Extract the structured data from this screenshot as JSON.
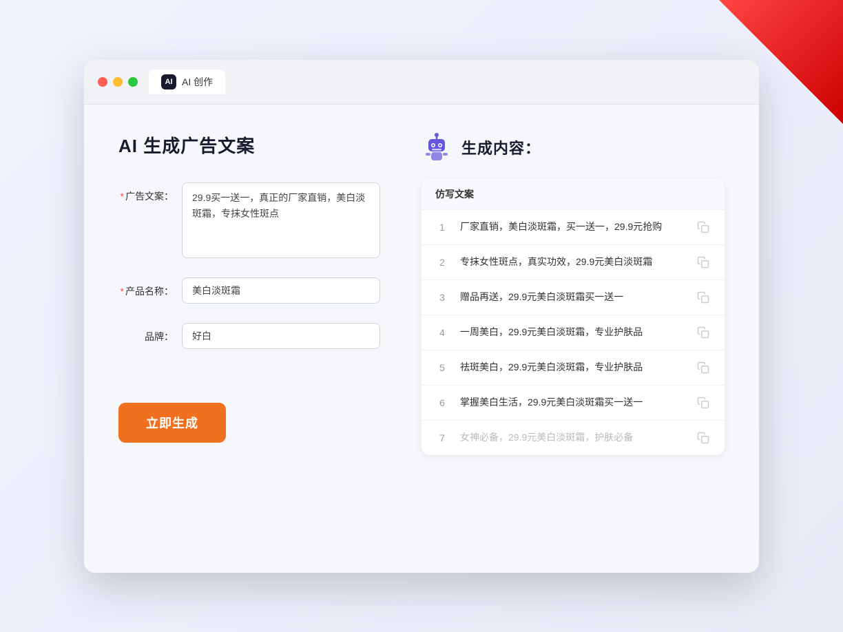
{
  "window": {
    "tab_label": "AI 创作",
    "tab_icon": "AI"
  },
  "left_panel": {
    "title": "AI 生成广告文案",
    "fields": [
      {
        "label": "广告文案：",
        "required": true,
        "type": "textarea",
        "value": "29.9买一送一，真正的厂家直销，美白淡斑霜，专抹女性斑点",
        "name": "ad-copy-input"
      },
      {
        "label": "产品名称：",
        "required": true,
        "type": "text",
        "value": "美白淡斑霜",
        "name": "product-name-input"
      },
      {
        "label": "品牌：",
        "required": false,
        "type": "text",
        "value": "好白",
        "name": "brand-input"
      }
    ],
    "button_label": "立即生成"
  },
  "right_panel": {
    "title": "生成内容：",
    "table_header": "仿写文案",
    "results": [
      {
        "num": "1",
        "text": "厂家直销，美白淡斑霜，买一送一，29.9元抢购",
        "faded": false
      },
      {
        "num": "2",
        "text": "专抹女性斑点，真实功效，29.9元美白淡斑霜",
        "faded": false
      },
      {
        "num": "3",
        "text": "赠品再送，29.9元美白淡斑霜买一送一",
        "faded": false
      },
      {
        "num": "4",
        "text": "一周美白，29.9元美白淡斑霜，专业护肤品",
        "faded": false
      },
      {
        "num": "5",
        "text": "祛斑美白，29.9元美白淡斑霜，专业护肤品",
        "faded": false
      },
      {
        "num": "6",
        "text": "掌握美白生活，29.9元美白淡斑霜买一送一",
        "faded": false
      },
      {
        "num": "7",
        "text": "女神必备，29.9元美白淡斑霜，护肤必备",
        "faded": true
      }
    ]
  },
  "colors": {
    "orange": "#f07020",
    "required": "#ff4d4f",
    "title_dark": "#1a1a2e"
  }
}
